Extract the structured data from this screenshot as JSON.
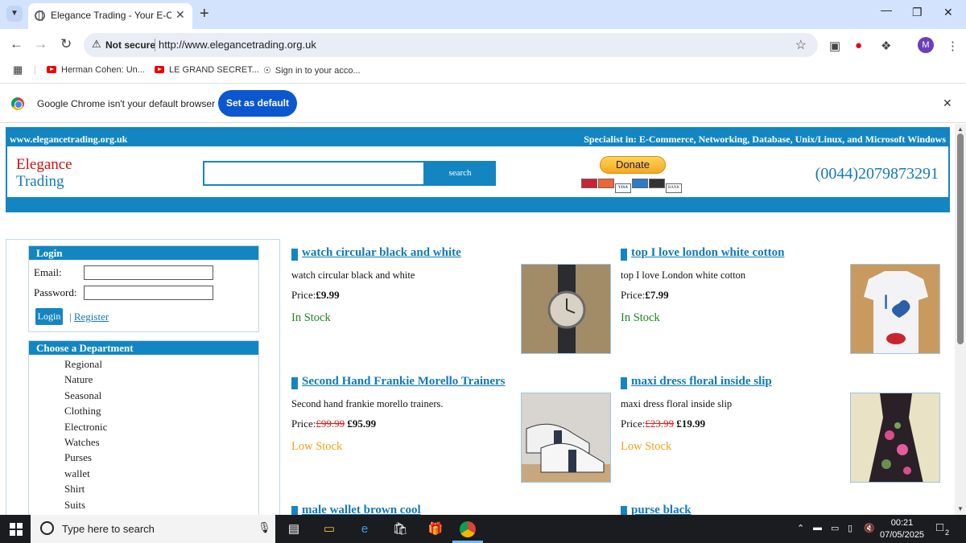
{
  "browser": {
    "tab_title": "Elegance Trading - Your E-Com",
    "security_label": "Not secure",
    "url": "http://www.elegancetrading.org.uk",
    "avatar_letter": "M",
    "bookmarks": [
      {
        "label": "Herman Cohen: Un..."
      },
      {
        "label": "LE GRAND SECRET..."
      },
      {
        "label": "Sign in to your acco..."
      }
    ],
    "infobar": {
      "message": "Google Chrome isn't your default browser",
      "button_label": "Set as default"
    }
  },
  "site": {
    "domain": "www.elegancetrading.org.uk",
    "specialist": "Specialist in: E-Commerce, Networking, Database, Unix/Linux, and Microsoft Windows",
    "logo_line1": "Elegance",
    "logo_line2": "Trading",
    "search_button": "search",
    "donate_label": "Donate",
    "phone": "(0044)2079873291",
    "accent_color": "#1386c2"
  },
  "login": {
    "title": "Login",
    "email_label": "Email:",
    "password_label": "Password:",
    "login_button": "Login",
    "separator": "|",
    "register_link": "Register"
  },
  "departments": {
    "title": "Choose a Department",
    "items": [
      "Regional",
      "Nature",
      "Seasonal",
      "Clothing",
      "Electronic",
      "Watches",
      "Purses",
      "wallet",
      "Shirt",
      "Suits"
    ]
  },
  "products": [
    {
      "title": "watch circular black and white",
      "description": "watch circular black and white",
      "price_label": "Price:",
      "old_price": "",
      "price": "£9.99",
      "stock": "In Stock"
    },
    {
      "title": "top I love london white cotton",
      "description": "top I love London white cotton",
      "price_label": "Price:",
      "old_price": "",
      "price": "£7.99",
      "stock": "In Stock"
    },
    {
      "title": "Second Hand Frankie Morello Trainers",
      "description": "Second hand frankie morello trainers.",
      "price_label": "Price:",
      "old_price": "£99.99",
      "price": "£95.99",
      "stock": "Low Stock"
    },
    {
      "title": "maxi dress floral inside slip",
      "description": "maxi dress floral inside slip",
      "price_label": "Price:",
      "old_price": "£23.99",
      "price": "£19.99",
      "stock": "Low Stock"
    },
    {
      "title": "male wallet brown cool"
    },
    {
      "title": "purse black"
    }
  ],
  "taskbar": {
    "search_placeholder": "Type here to search",
    "time": "00:21",
    "date": "07/05/2025",
    "notification_count": "2"
  }
}
